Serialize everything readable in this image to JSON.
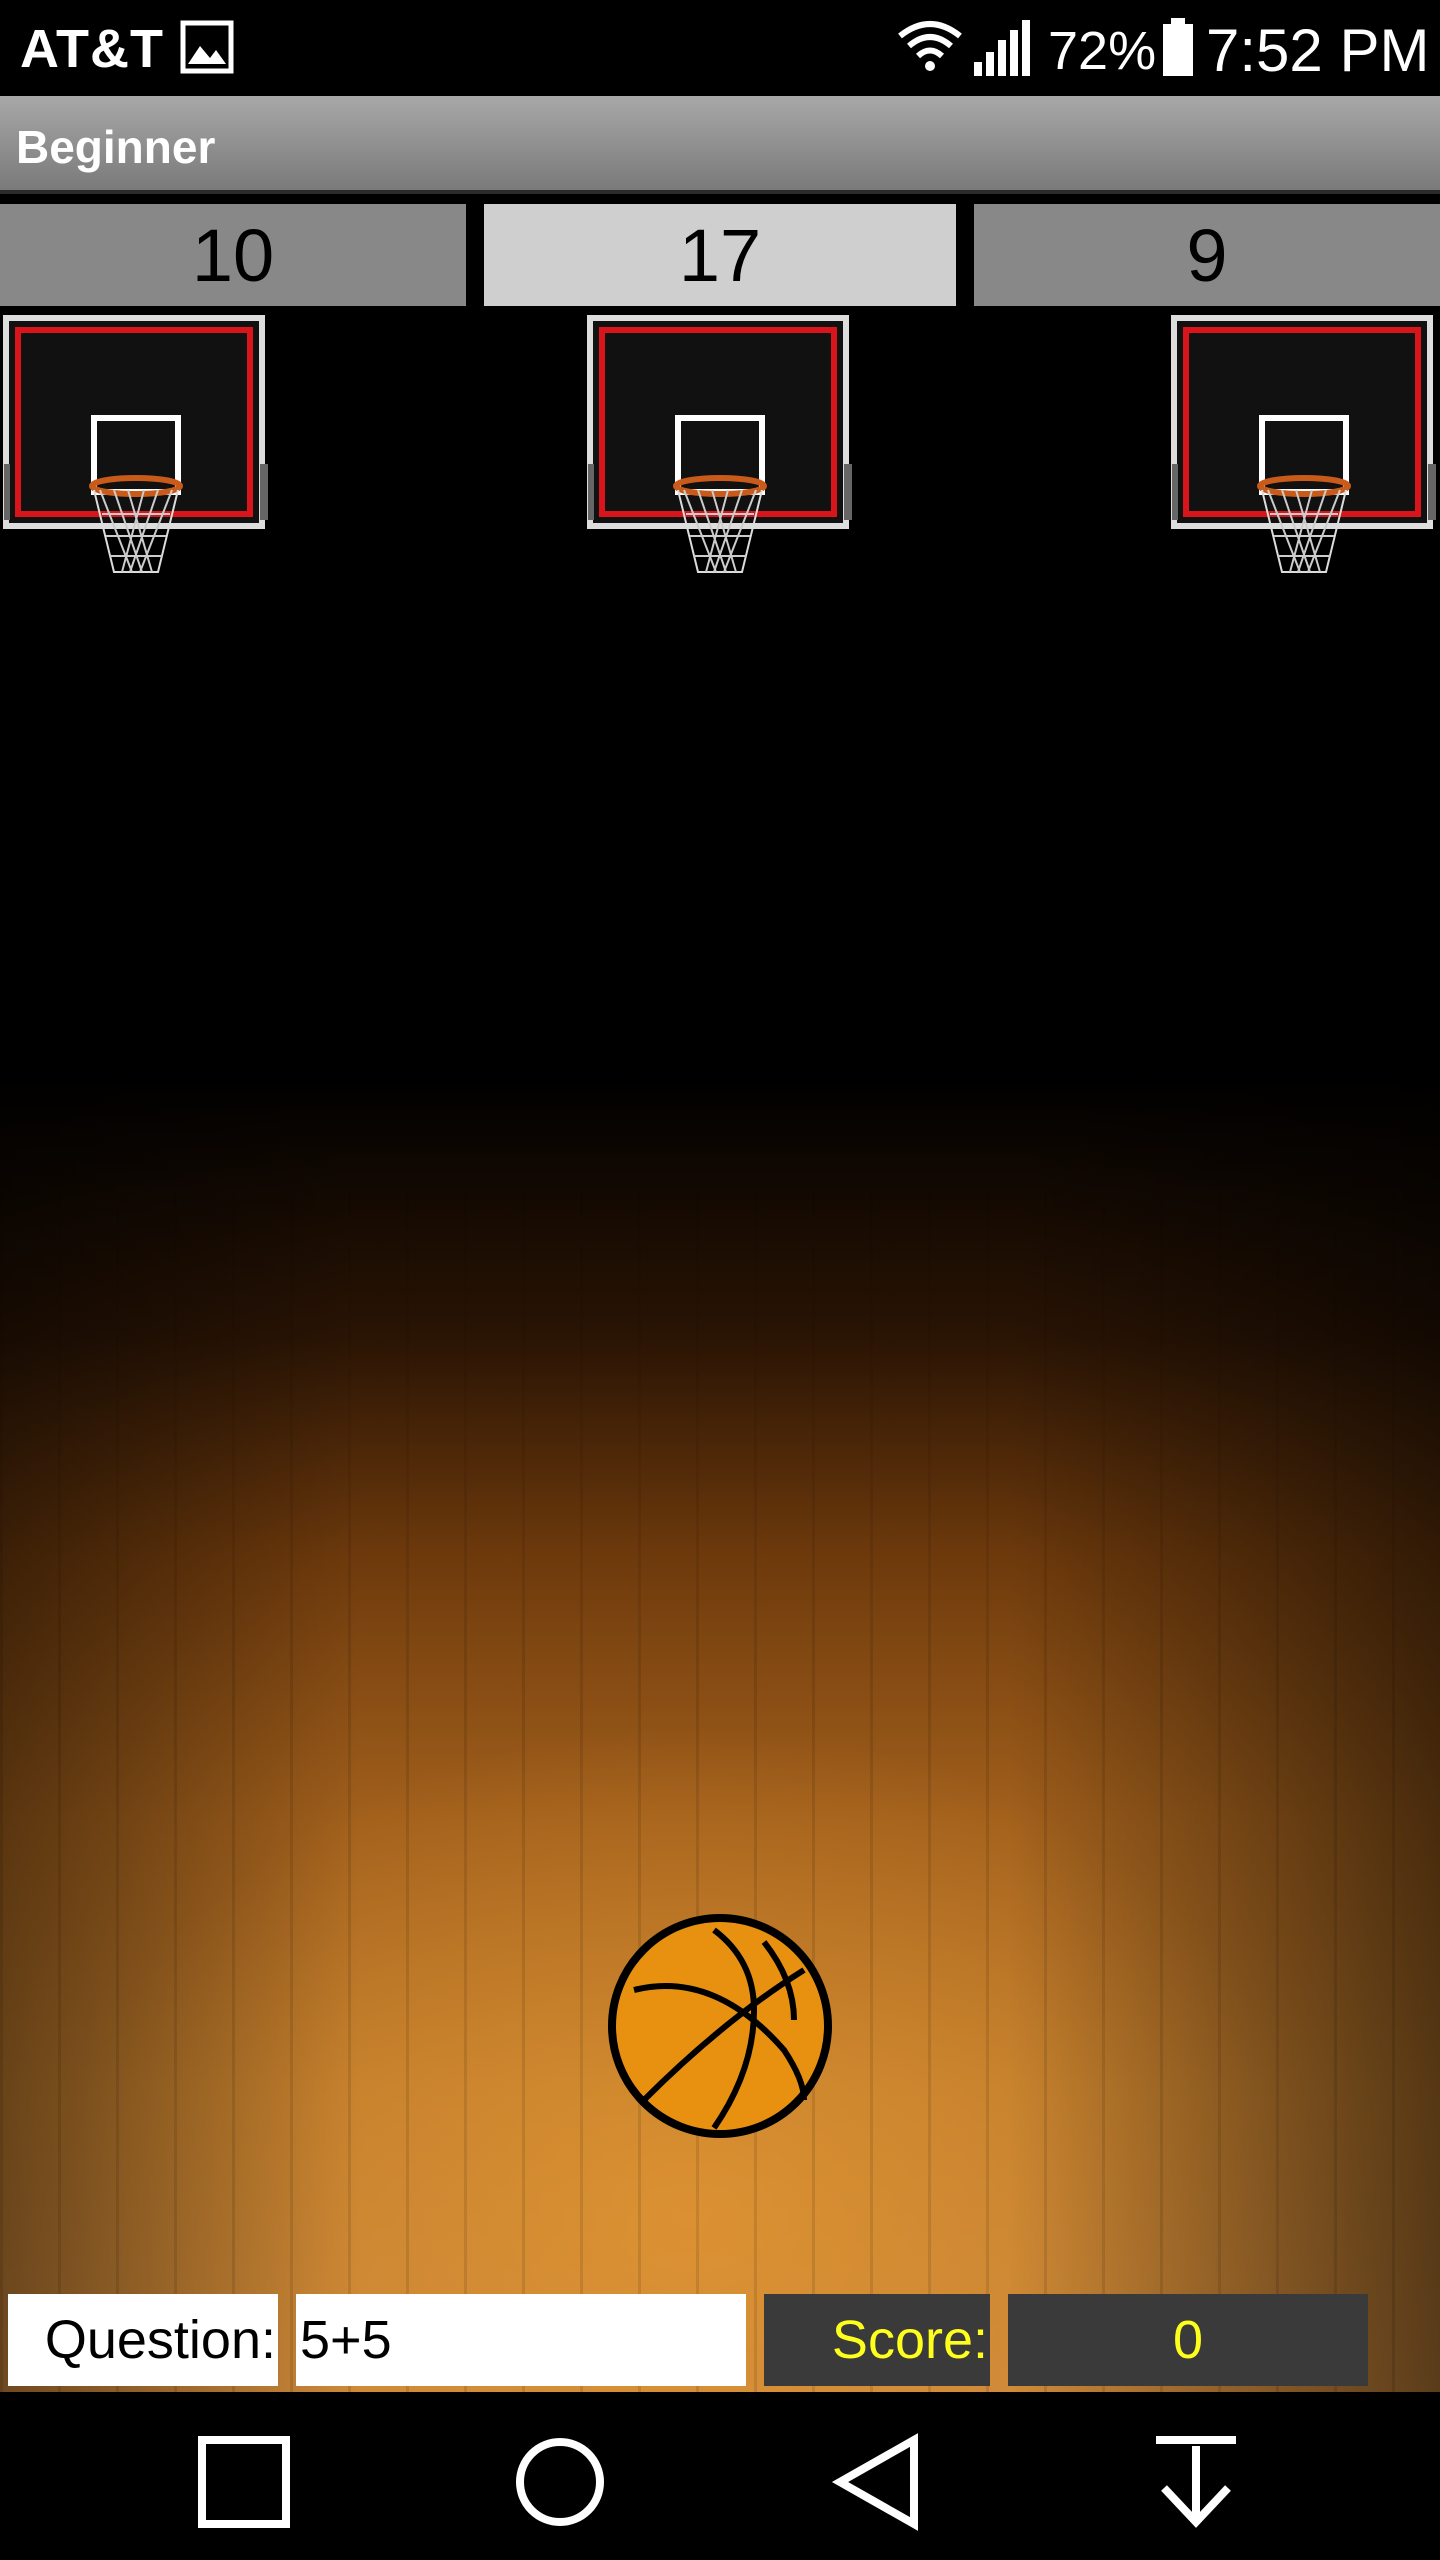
{
  "status_bar": {
    "carrier": "AT&T",
    "battery_percent": "72%",
    "time": "7:52 PM",
    "icons": [
      "gallery-icon",
      "wifi-icon",
      "signal-icon",
      "battery-icon"
    ]
  },
  "title_bar": {
    "title": "Beginner"
  },
  "answers": [
    {
      "label": "10",
      "selected": false
    },
    {
      "label": "17",
      "selected": true
    },
    {
      "label": "9",
      "selected": false
    }
  ],
  "game": {
    "hoops": [
      "hoop-icon",
      "hoop-icon",
      "hoop-icon"
    ],
    "ball": "basketball-icon"
  },
  "bottom_panel": {
    "question_label": "Question:",
    "question_value": "5+5",
    "score_label": "Score:",
    "score_value": "0"
  },
  "colors": {
    "score_text": "#ffff1e",
    "ball_orange": "#e8900f",
    "rim_red": "#d9141a",
    "answer_selected_bg": "#cfcfcf",
    "answer_bg": "#888888"
  },
  "nav_bar": {
    "buttons": [
      "recent-apps-icon",
      "home-icon",
      "back-icon",
      "notification-pull-icon"
    ]
  }
}
